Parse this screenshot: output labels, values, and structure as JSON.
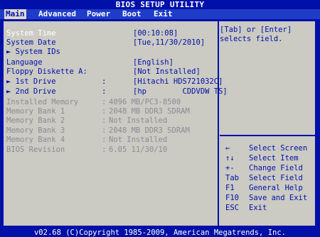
{
  "title": "BIOS SETUP UTILITY",
  "menu": [
    {
      "label": "Main",
      "active": true
    },
    {
      "label": "Advanced"
    },
    {
      "label": "Power"
    },
    {
      "label": "Boot"
    },
    {
      "label": "Exit"
    }
  ],
  "settings": {
    "system_time": {
      "label": "System Time",
      "value": "[00:10:08]"
    },
    "system_date": {
      "label": "System Date",
      "value": "[Tue,11/30/2010]"
    },
    "system_ids": {
      "label": "► System IDs"
    },
    "language": {
      "label": "Language",
      "value": "[English]"
    },
    "floppy": {
      "label": "Floppy Diskette A:",
      "value": "[Not Installed]"
    },
    "first_drive": {
      "label": "► 1st Drive",
      "value": "[Hitachi HDS721032C]"
    },
    "second_drive": {
      "label": "► 2nd Drive",
      "value": "[hp        CDDVDW TS]"
    },
    "installed_memory": {
      "label": "Installed Memory",
      "value": "4096 MB/PC3-8500"
    },
    "bank1": {
      "label": "Memory Bank 1",
      "value": "2048 MB DDR3 SDRAM"
    },
    "bank2": {
      "label": "Memory Bank 2",
      "value": "Not Installed"
    },
    "bank3": {
      "label": "Memory Bank 3",
      "value": "2048 MB DDR3 SDRAM"
    },
    "bank4": {
      "label": "Memory Bank 4",
      "value": "Not Installed"
    },
    "bios_revision": {
      "label": "BIOS Revision",
      "value": "6.05 11/30/10"
    }
  },
  "help": {
    "line1": "[Tab] or [Enter]",
    "line2": "selects field."
  },
  "keys": [
    {
      "key": "←",
      "desc": "Select Screen"
    },
    {
      "key": "↑↓",
      "desc": "Select Item"
    },
    {
      "key": "+-",
      "desc": "Change Field"
    },
    {
      "key": "Tab",
      "desc": "Select Field"
    },
    {
      "key": "F1",
      "desc": "General Help"
    },
    {
      "key": "F10",
      "desc": "Save and Exit"
    },
    {
      "key": "ESC",
      "desc": "Exit"
    }
  ],
  "footer": "v02.68 (C)Copyright 1985-2009, American Megatrends, Inc.",
  "colors": {
    "background": "#0010a8",
    "panel": "#cbcac3",
    "menu_bar": "#1f3cc8"
  }
}
